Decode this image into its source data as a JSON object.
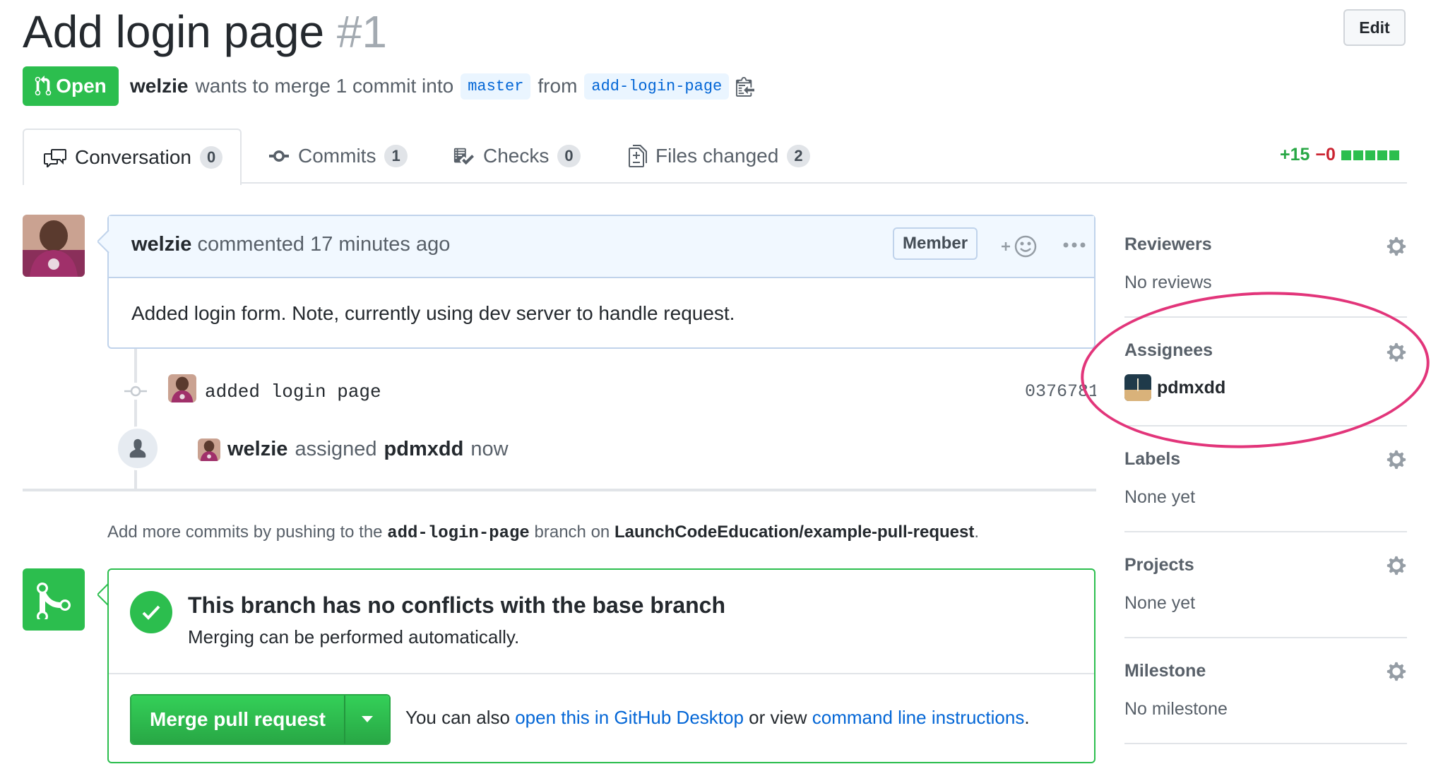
{
  "header": {
    "title": "Add login page",
    "number": "#1",
    "edit_label": "Edit",
    "state_label": "Open",
    "author": "welzie",
    "merge_text": "wants to merge 1 commit into",
    "base_branch": "master",
    "from_text": "from",
    "head_branch": "add-login-page"
  },
  "tabs": [
    {
      "label": "Conversation",
      "count": "0"
    },
    {
      "label": "Commits",
      "count": "1"
    },
    {
      "label": "Checks",
      "count": "0"
    },
    {
      "label": "Files changed",
      "count": "2"
    }
  ],
  "diffstat": {
    "additions": "+15",
    "deletions": "−0"
  },
  "comment": {
    "author": "welzie",
    "meta": "commented 17 minutes ago",
    "badge": "Member",
    "body": "Added login form. Note, currently using dev server to handle request."
  },
  "commit": {
    "message": "added login page",
    "sha": "0376781"
  },
  "event": {
    "actor": "welzie",
    "action": "assigned",
    "target": "pdmxdd",
    "time": "now"
  },
  "push_note": {
    "prefix": "Add more commits by pushing to the",
    "branch": "add-login-page",
    "middle": "branch on",
    "repo": "LaunchCodeEducation/example-pull-request",
    "suffix": "."
  },
  "merge": {
    "title": "This branch has no conflicts with the base branch",
    "subtitle": "Merging can be performed automatically.",
    "button_label": "Merge pull request",
    "note_prefix": "You can also",
    "link_desktop": "open this in GitHub Desktop",
    "note_middle": "or view",
    "link_cli": "command line instructions",
    "note_suffix": "."
  },
  "sidebar": {
    "reviewers": {
      "title": "Reviewers",
      "value": "No reviews"
    },
    "assignees": {
      "title": "Assignees",
      "value": "pdmxdd"
    },
    "labels": {
      "title": "Labels",
      "value": "None yet"
    },
    "projects": {
      "title": "Projects",
      "value": "None yet"
    },
    "milestone": {
      "title": "Milestone",
      "value": "No milestone"
    }
  },
  "colors": {
    "green": "#2cbe4e",
    "link": "#0366d6",
    "highlight": "#e2357a"
  }
}
